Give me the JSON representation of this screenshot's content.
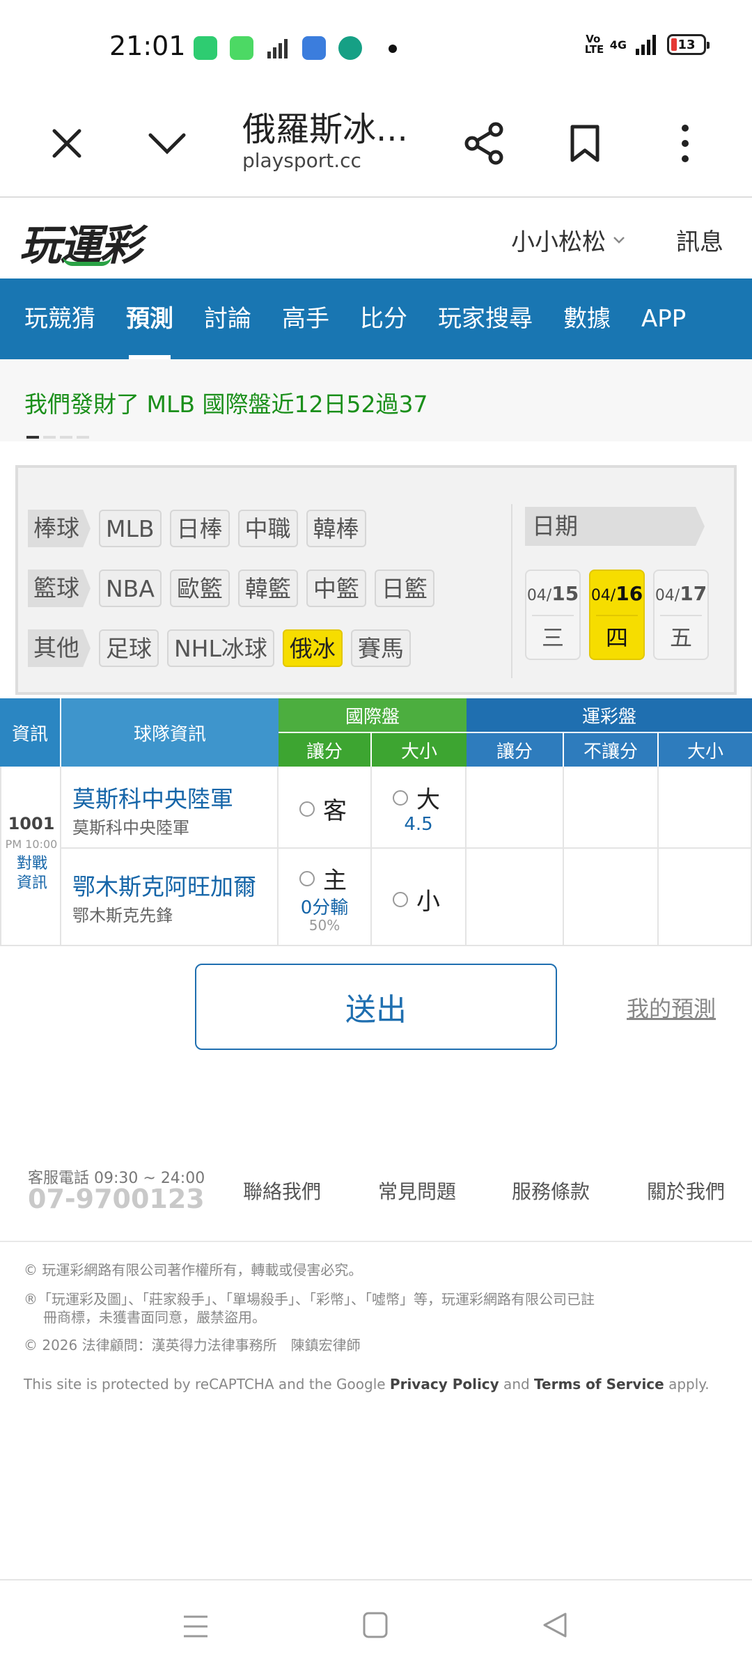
{
  "status_bar": {
    "time": "21:01",
    "network": "4G",
    "volte": "Vo LTE",
    "battery": "13",
    "app_icons": [
      {
        "name": "battery-app-icon",
        "color": "#2ecc71"
      },
      {
        "name": "store-app-icon",
        "color": "#4cd964"
      },
      {
        "name": "signal-app-icon",
        "color": "#333333"
      },
      {
        "name": "files-app-icon",
        "color": "#3b7ddd"
      },
      {
        "name": "chart-app-icon",
        "color": "#16a085"
      }
    ]
  },
  "browser": {
    "title": "俄羅斯冰...",
    "domain": "playsport.cc"
  },
  "site": {
    "logo": "玩運彩",
    "user_name": "小小松松",
    "messages": "訊息"
  },
  "nav": {
    "items": [
      "玩競猜",
      "預測",
      "討論",
      "高手",
      "比分",
      "玩家搜尋",
      "數據",
      "APP"
    ],
    "active_index": 1
  },
  "promo": {
    "text": "我們發財了 MLB 國際盤近12日52過37"
  },
  "filter": {
    "rows": [
      {
        "label": "棒球",
        "chips": [
          "MLB",
          "日棒",
          "中職",
          "韓棒"
        ]
      },
      {
        "label": "籃球",
        "chips": [
          "NBA",
          "歐籃",
          "韓籃",
          "中籃",
          "日籃"
        ]
      },
      {
        "label": "其他",
        "chips": [
          "足球",
          "NHL冰球",
          "俄冰",
          "賽馬"
        ]
      }
    ],
    "selected_chip": "俄冰",
    "date_label": "日期",
    "dates": [
      {
        "month": "04/",
        "day": "15",
        "weekday": "三",
        "selected": false
      },
      {
        "month": "04/",
        "day": "16",
        "weekday": "四",
        "selected": true
      },
      {
        "month": "04/",
        "day": "17",
        "weekday": "五",
        "selected": false
      }
    ]
  },
  "table": {
    "headers": {
      "info": "資訊",
      "team_info": "球隊資訊",
      "intl": "國際盤",
      "sports_lottery": "運彩盤",
      "intl_spread": "讓分",
      "intl_total": "大小",
      "lot_spread": "讓分",
      "lot_nospread": "不讓分",
      "lot_total": "大小"
    },
    "game": {
      "number": "1001",
      "time": "PM 10:00",
      "matchup_link": "對戰資訊",
      "away": {
        "name": "莫斯科中央陸軍",
        "sub": "莫斯科中央陸軍",
        "spread_label": "客",
        "total_label": "大",
        "total_value": "4.5"
      },
      "home": {
        "name": "鄂木斯克阿旺加爾",
        "sub": "鄂木斯克先鋒",
        "spread_label": "主",
        "spread_value": "0分輸",
        "spread_pct": "50%",
        "total_label": "小"
      }
    }
  },
  "actions": {
    "submit": "送出",
    "my_predictions": "我的預測"
  },
  "footer": {
    "phone_label": "客服電話 09:30 ~ 24:00",
    "phone": "07-9700123",
    "links": [
      "聯絡我們",
      "常見問題",
      "服務條款",
      "關於我們"
    ],
    "copyright": "© 玩運彩網路有限公司著作權所有，轉載或侵害必究。",
    "trademark_1": "®「玩運彩及圖」、「莊家殺手」、「單場殺手」、「彩幣」、「噓幣」等，玩運彩網路有限公司已註",
    "trademark_2": "冊商標，未獲書面同意，嚴禁盜用。",
    "legal": "© 2026 法律顧問：漢英得力法律事務所　陳鎮宏律師",
    "recaptcha_pre": "This site is protected by reCAPTCHA and the Google ",
    "privacy": "Privacy Policy",
    "and": " and ",
    "terms": "Terms of Service",
    "apply": " apply."
  },
  "colors": {
    "nav_blue": "#1976b2",
    "promo_green": "#1a8f1a",
    "selected_yellow": "#f6dd00",
    "intl_green": "#4cae3f",
    "lottery_blue": "#1f6fb0"
  }
}
